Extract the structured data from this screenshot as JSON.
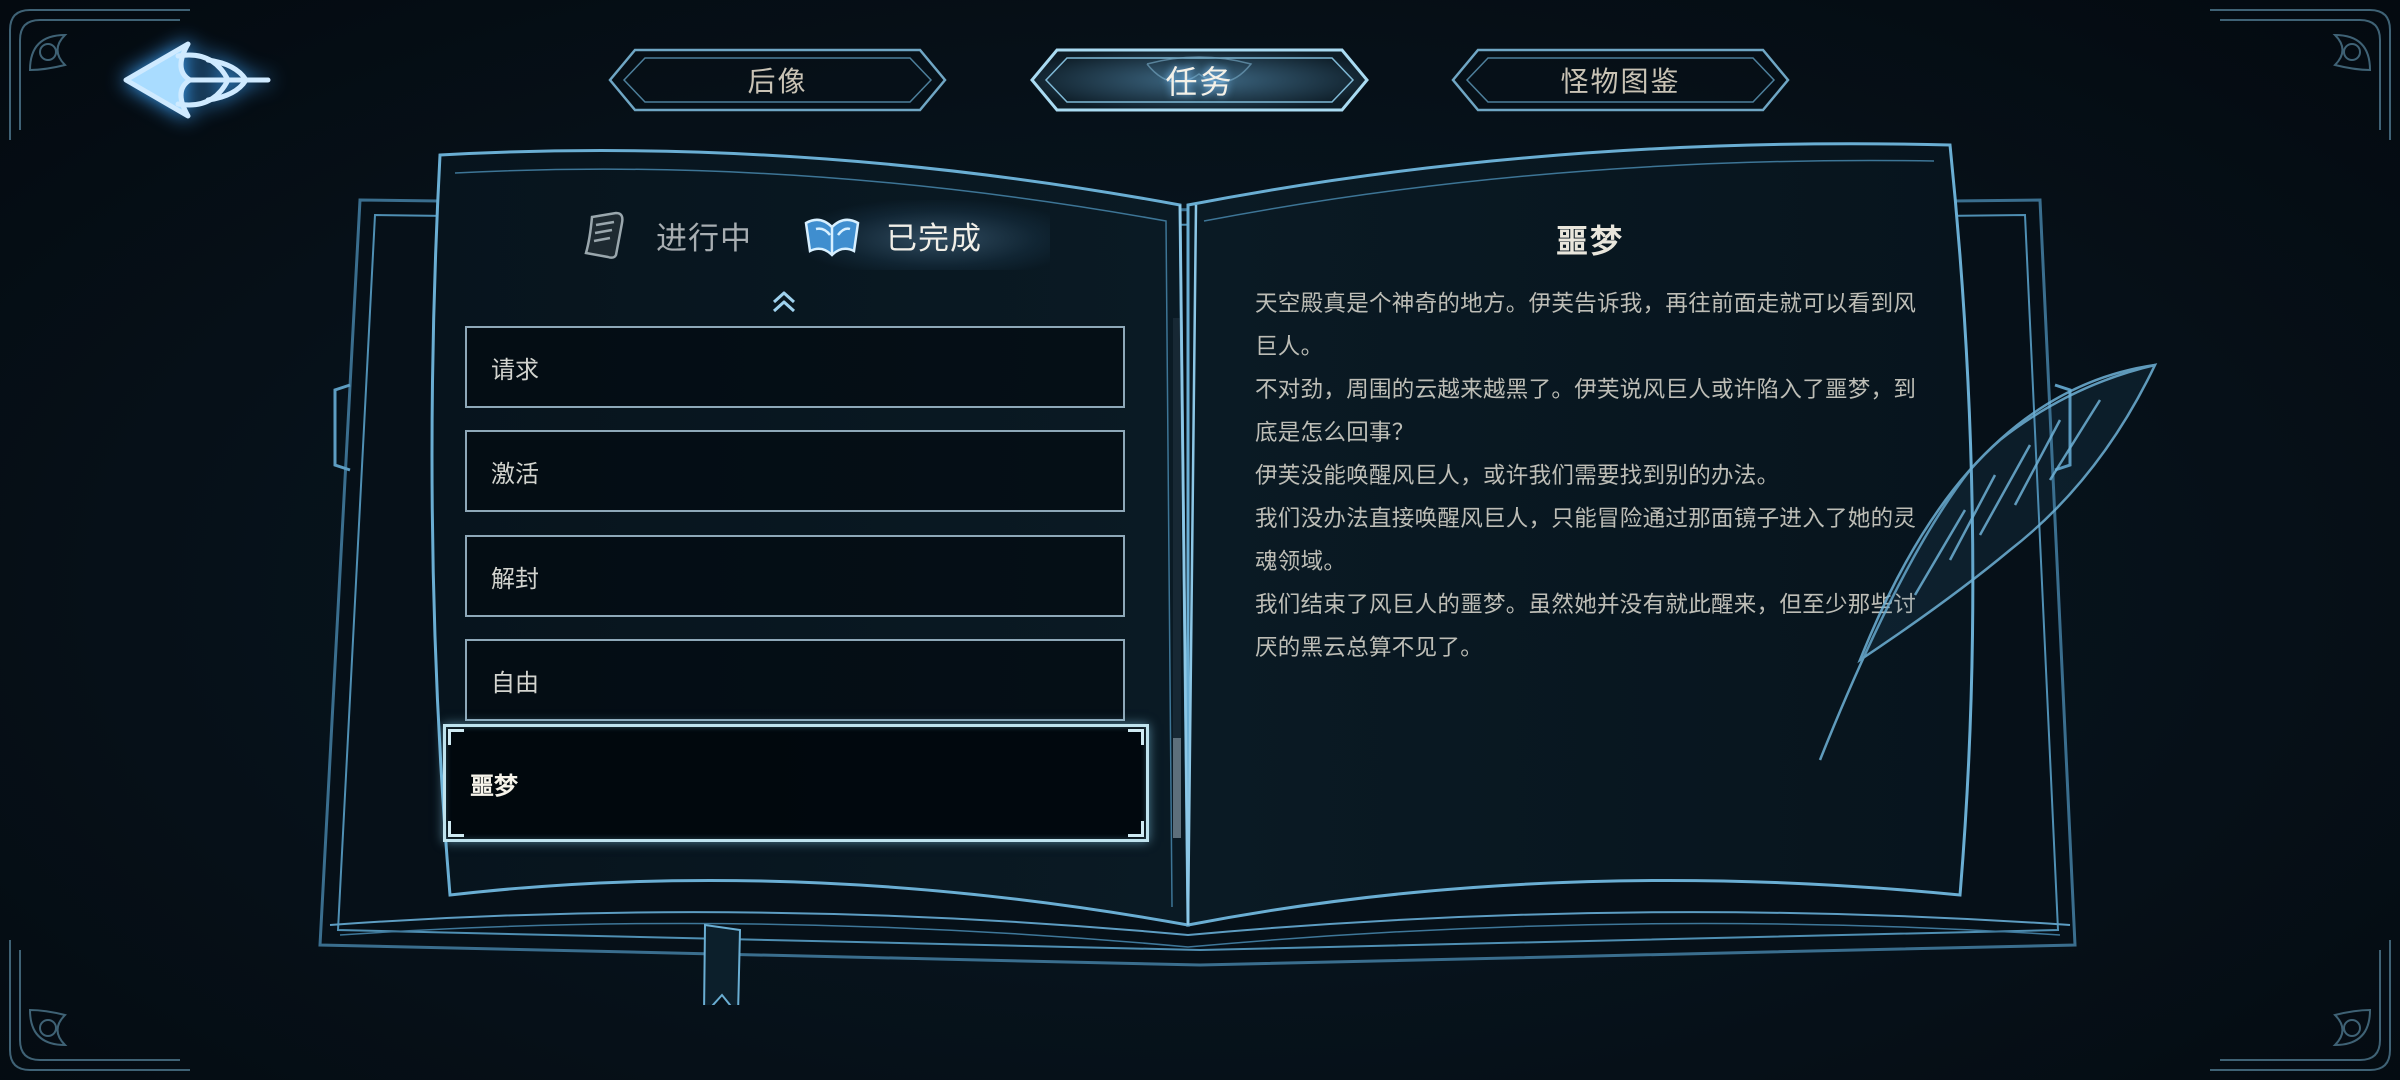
{
  "top_tabs": {
    "afterimage": "后像",
    "quest": "任务",
    "bestiary": "怪物图鉴"
  },
  "sub_tabs": {
    "in_progress": "进行中",
    "completed": "已完成"
  },
  "quests": [
    {
      "label": "请求"
    },
    {
      "label": "激活"
    },
    {
      "label": "解封"
    },
    {
      "label": "自由"
    },
    {
      "label": "噩梦"
    }
  ],
  "detail": {
    "title": "噩梦",
    "paragraphs": [
      "天空殿真是个神奇的地方。伊芙告诉我，再往前面走就可以看到风巨人。",
      "不对劲，周围的云越来越黑了。伊芙说风巨人或许陷入了噩梦，到底是怎么回事？",
      "伊芙没能唤醒风巨人，或许我们需要找到别的办法。",
      "我们没办法直接唤醒风巨人，只能冒险通过那面镜子进入了她的灵魂领域。",
      "我们结束了风巨人的噩梦。虽然她并没有就此醒来，但至少那些讨厌的黑云总算不见了。"
    ]
  },
  "colors": {
    "glow": "#7fc6ff",
    "frame_line": "#8ea8b8",
    "selected_border": "#bfe3ee"
  },
  "icons": {
    "back": "back-arrow-icon",
    "in_progress": "scroll-icon",
    "completed": "open-book-icon",
    "scroll_up": "double-chevron-up-icon"
  }
}
